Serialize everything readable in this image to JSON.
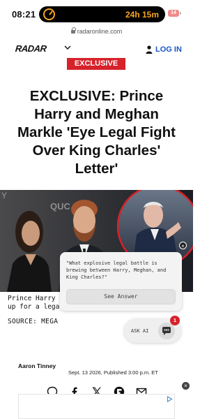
{
  "status_bar": {
    "time": "08:21",
    "activity_timer": "24h 15m",
    "battery": "14"
  },
  "browser": {
    "url": "radaronline.com"
  },
  "site_header": {
    "logo": "RADAR",
    "login_label": "LOG IN"
  },
  "article": {
    "badge": "EXCLUSIVE",
    "headline": "EXCLUSIVE: Prince Harry and Meghan Markle 'Eye Legal Fight Over King Charles' Letter'",
    "caption": "Prince Harry ar",
    "caption_line2": "up for a legal fi",
    "source": "SOURCE: MEGA",
    "author": "Aaron Tinney",
    "published": "Sept. 13 2026, Published 3:00 p.m. ET"
  },
  "ai_popup": {
    "question": "\"What explosive legal battle is brewing between Harry, Meghan, and King Charles?\"",
    "see_answer_label": "See Answer",
    "close_label": "×"
  },
  "ask_ai": {
    "label": "ASK AI",
    "notification_count": "1"
  },
  "ad": {
    "close_label": "×"
  },
  "share": {
    "icons": [
      "comment-icon",
      "facebook-icon",
      "x-icon",
      "flipboard-icon",
      "email-icon"
    ]
  },
  "colors": {
    "brand_red": "#d6222a",
    "login_blue": "#1a56c4",
    "timer_orange": "#f5a623"
  }
}
